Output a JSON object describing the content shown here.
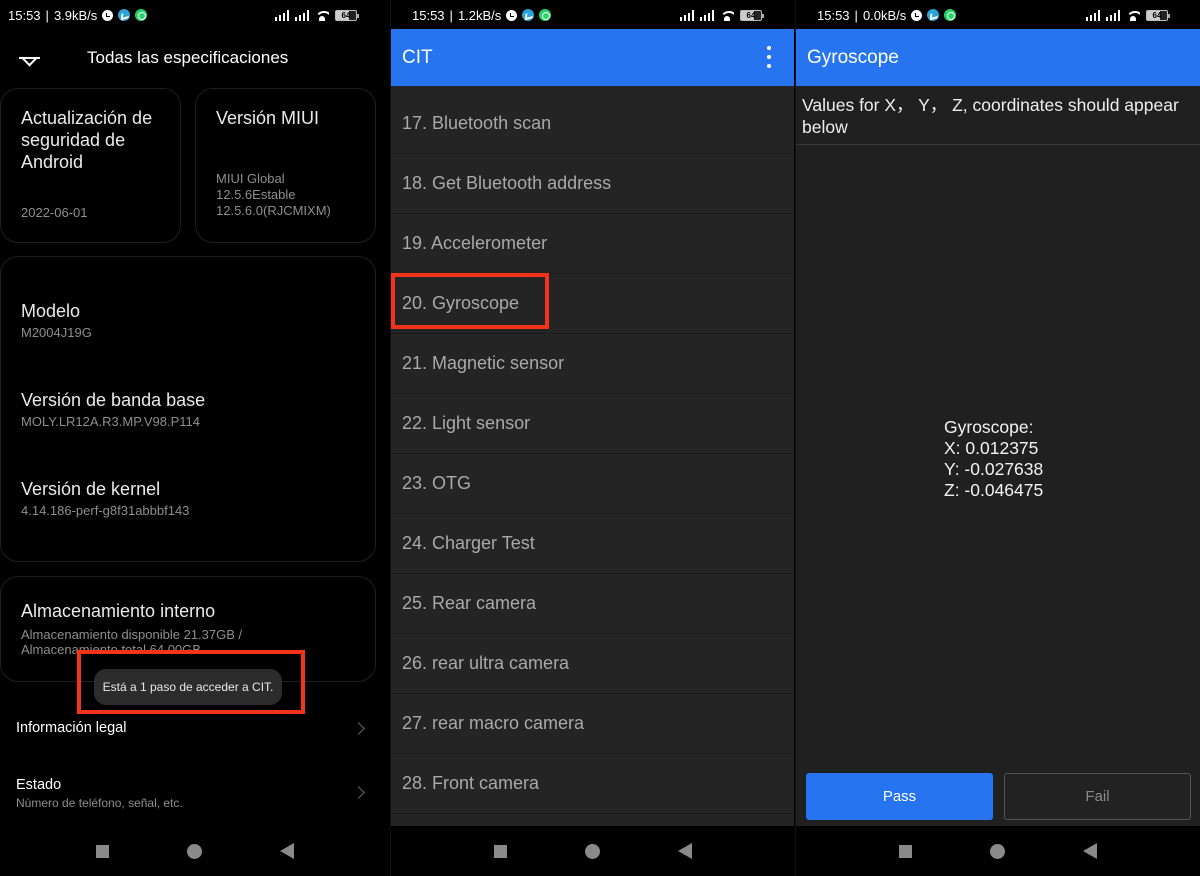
{
  "panels": [
    {
      "status": {
        "time": "15:53",
        "speed": "3.9kB/s",
        "battery": "64"
      },
      "header": {
        "title": "Todas las especificaciones"
      },
      "security_card": {
        "title": "Actualización de seguridad de Android",
        "value": "2022-06-01"
      },
      "miui_card": {
        "title": "Versión MIUI",
        "value_lines": [
          "MIUI Global",
          "12.5.6Estable",
          "12.5.6.0(RJCMIXM)"
        ]
      },
      "specs": [
        {
          "title": "Modelo",
          "value": "M2004J19G"
        },
        {
          "title": "Versión de banda base",
          "value": "MOLY.LR12A.R3.MP.V98.P114"
        },
        {
          "title": "Versión de kernel",
          "value": "4.14.186-perf-g8f31abbbf143"
        }
      ],
      "storage": {
        "title": "Almacenamiento interno",
        "line1": "Almacenamiento disponible  21.37GB /",
        "line2": "Almacenamiento total  64.00GB"
      },
      "toast": "Está a 1 paso de acceder a CIT.",
      "menu": [
        {
          "title": "Información legal",
          "subtitle": ""
        },
        {
          "title": "Estado",
          "subtitle": "Número de teléfono, señal, etc."
        }
      ]
    },
    {
      "status": {
        "time": "15:53",
        "speed": "1.2kB/s",
        "battery": "64"
      },
      "appbar": {
        "title": "CIT"
      },
      "items": [
        "17. Bluetooth scan",
        "18. Get Bluetooth address",
        "19. Accelerometer",
        "20. Gyroscope",
        "21. Magnetic sensor",
        "22. Light sensor",
        "23. OTG",
        "24. Charger Test",
        "25. Rear camera",
        "26. rear ultra camera",
        "27. rear macro camera",
        "28. Front camera"
      ],
      "highlighted_item": "20. Gyroscope"
    },
    {
      "status": {
        "time": "15:53",
        "speed": "0.0kB/s",
        "battery": "64"
      },
      "appbar": {
        "title": "Gyroscope"
      },
      "instruction": "Values for X， Y， Z, coordinates should appear below",
      "readout": {
        "label": "Gyroscope:",
        "x": "X: 0.012375",
        "y": "Y: -0.027638",
        "z": "Z: -0.046475"
      },
      "buttons": {
        "pass": "Pass",
        "fail": "Fail"
      }
    }
  ],
  "colors": {
    "accent": "#2674f0",
    "highlight": "#f5331a"
  }
}
